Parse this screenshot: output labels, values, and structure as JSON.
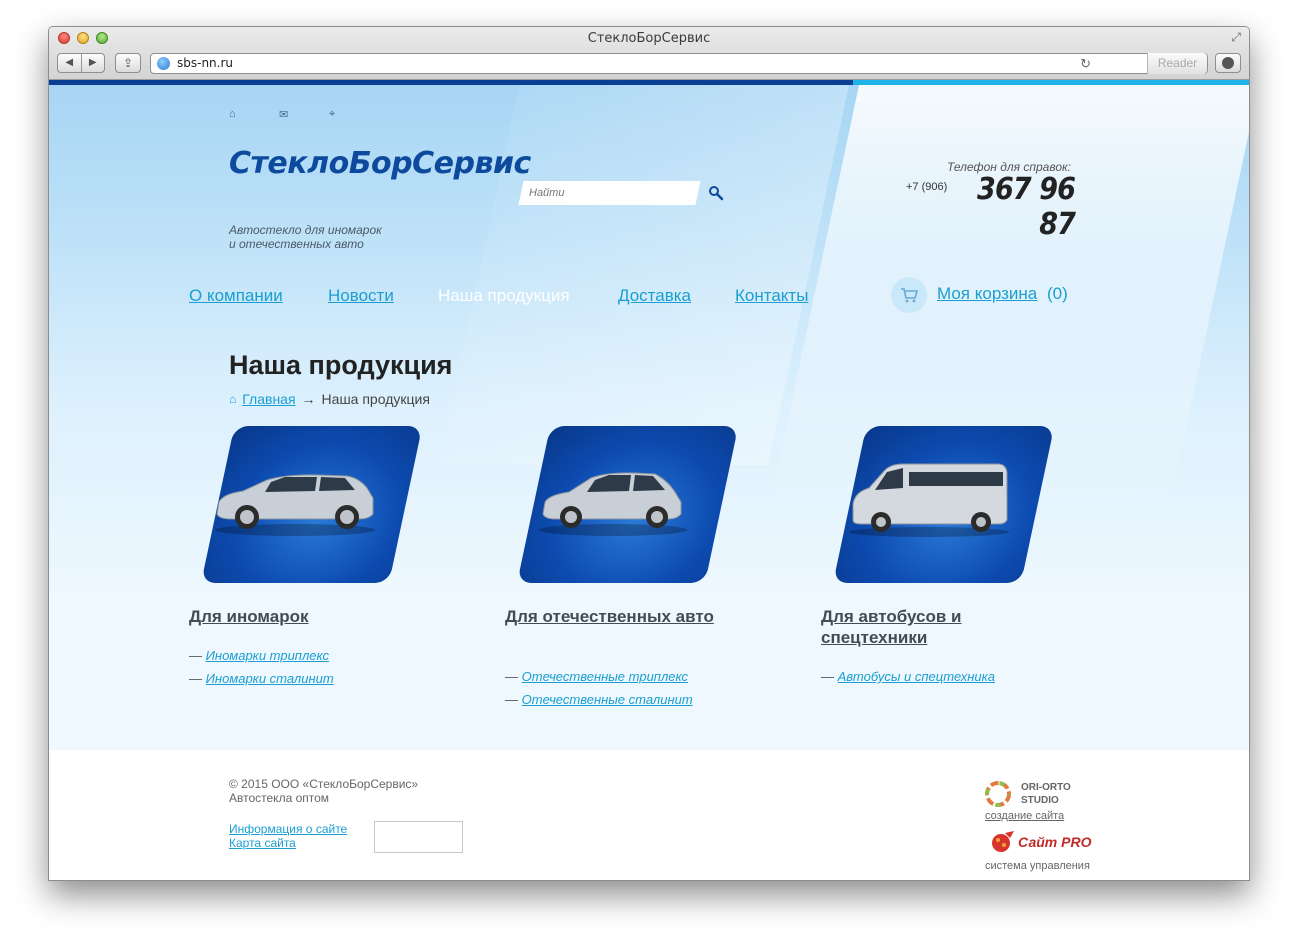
{
  "browser": {
    "title": "СтеклоБорСервис",
    "url": "sbs-nn.ru",
    "reader_label": "Reader"
  },
  "header": {
    "logo": "СтеклоБорСервис",
    "tagline_1": "Автостекло для иномарок",
    "tagline_2": "и отечественных авто",
    "search_placeholder": "Найти",
    "phone_label": "Телефон для справок:",
    "phone_prefix": "+7 (906)",
    "phone_number": "367 96 87"
  },
  "nav": {
    "items": [
      {
        "label": "О компании",
        "active": false
      },
      {
        "label": "Новости",
        "active": false
      },
      {
        "label": "Наша продукция",
        "active": true
      },
      {
        "label": "Доставка",
        "active": false
      },
      {
        "label": "Контакты",
        "active": false
      }
    ],
    "cart_label": "Моя корзина",
    "cart_count": "(0)"
  },
  "main": {
    "title": "Наша продукция",
    "breadcrumb": {
      "home": "Главная",
      "arrow": "→",
      "current": "Наша продукция"
    },
    "products": [
      {
        "title": "Для иномарок",
        "links": [
          "Иномарки триплекс",
          "Иномарки сталинит"
        ],
        "image": "suv-car-image"
      },
      {
        "title": "Для отечественных авто",
        "links": [
          "Отечественные триплекс",
          "Отечественные сталинит"
        ],
        "image": "hatchback-car-image"
      },
      {
        "title": "Для автобусов и спецтехники",
        "links": [
          "Автобусы и спецтехника"
        ],
        "image": "minibus-image"
      }
    ],
    "link_prefix": "—"
  },
  "footer": {
    "copyright": "© 2015 ООО «СтеклоБорСервис»",
    "subtitle": "Автостекла оптом",
    "links": [
      "Информация о сайте",
      "Карта сайта"
    ],
    "studio_name_1": "ORI-ORTO",
    "studio_name_2": "STUDIO",
    "studio_caption": "создание сайта",
    "cms_name": "Сайт PRO",
    "cms_caption": "система управления"
  },
  "colors": {
    "brand_dark": "#0c3f93",
    "link": "#1a9fd0",
    "accent_strip": "#1fb3e8"
  }
}
